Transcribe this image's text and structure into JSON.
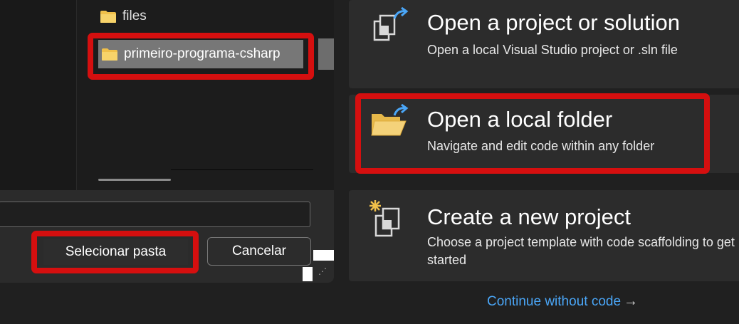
{
  "folder_dialog": {
    "tree_items": [
      {
        "label": "files",
        "icon": "folder-icon"
      },
      {
        "label": "primeiro-programa-csharp",
        "icon": "folder-icon",
        "selected": true
      }
    ],
    "path_value": "",
    "select_button": "Selecionar pasta",
    "cancel_button": "Cancelar"
  },
  "start_window": {
    "options": [
      {
        "title": "Open a project or solution",
        "description": "Open a local Visual Studio project or .sln file",
        "icon": "open-project-icon"
      },
      {
        "title": "Open a local folder",
        "description": "Navigate and edit code within any folder",
        "icon": "open-folder-icon"
      },
      {
        "title": "Create a new project",
        "description": "Choose a project template with code scaffolding to get started",
        "icon": "new-project-icon"
      }
    ],
    "continue_link": "Continue without code",
    "continue_arrow": "→"
  },
  "colors": {
    "highlight": "#d50f0f",
    "link": "#4aa6f7",
    "folder": "#f0c04a",
    "card_bg": "#2c2c2c"
  }
}
